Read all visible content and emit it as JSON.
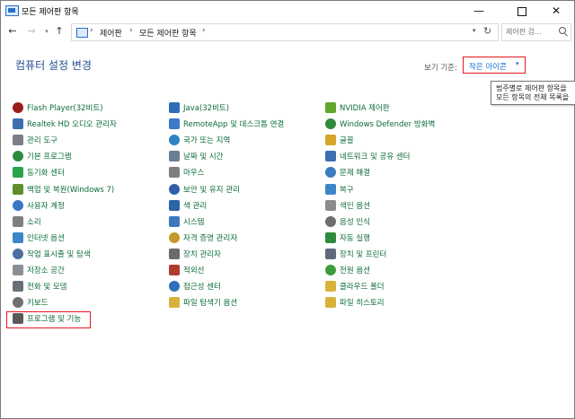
{
  "window": {
    "title": "모든 제어판 항목",
    "minimize": "—",
    "close": "✕"
  },
  "address": {
    "breadcrumb": [
      "제어판",
      "모든 제어판 항목"
    ],
    "separator": "›",
    "dropdown": "▾",
    "refresh": "↻",
    "search_placeholder": "제어판 검..."
  },
  "nav": {
    "back": "←",
    "forward": "→",
    "history": "▾",
    "up": "↑"
  },
  "heading": "컴퓨터 설정 변경",
  "view_by": {
    "label": "보기 기준:",
    "value": "작은 아이콘",
    "arrow": "▾"
  },
  "tooltip": {
    "line1": "범주별로 제어판 항목을",
    "line2": "모든 항목의 전체 목록을"
  },
  "columns": [
    [
      {
        "label": "Flash Player(32비트)",
        "icon": "flash-icon",
        "color": "#9b1c1c"
      },
      {
        "label": "Realtek HD 오디오 관리자",
        "icon": "speaker-icon",
        "color": "#3d6fb0"
      },
      {
        "label": "관리 도구",
        "icon": "admin-tools-icon",
        "color": "#7a7f86"
      },
      {
        "label": "기본 프로그램",
        "icon": "default-programs-icon",
        "color": "#2e8b3e"
      },
      {
        "label": "동기화 센터",
        "icon": "sync-icon",
        "color": "#2aa34a"
      },
      {
        "label": "백업 및 복원(Windows 7)",
        "icon": "backup-icon",
        "color": "#5e8f2a"
      },
      {
        "label": "사용자 계정",
        "icon": "user-icon",
        "color": "#3b78c2"
      },
      {
        "label": "소리",
        "icon": "sound-icon",
        "color": "#7f7f7f"
      },
      {
        "label": "인터넷 옵션",
        "icon": "internet-icon",
        "color": "#3c86c9"
      },
      {
        "label": "작업 표시줄 및 탐색",
        "icon": "taskbar-icon",
        "color": "#4b6f9e"
      },
      {
        "label": "저장소 공간",
        "icon": "storage-icon",
        "color": "#8a8f96"
      },
      {
        "label": "전화 및 모뎀",
        "icon": "phone-icon",
        "color": "#6b7078"
      },
      {
        "label": "키보드",
        "icon": "keyboard-icon",
        "color": "#707070"
      },
      {
        "label": "프로그램 및 기능",
        "icon": "programs-icon",
        "color": "#5a5a5a"
      }
    ],
    [
      {
        "label": "Java(32비트)",
        "icon": "java-icon",
        "color": "#2f6db5"
      },
      {
        "label": "RemoteApp 및 데스크톱 연결",
        "icon": "remote-icon",
        "color": "#3b7bc8"
      },
      {
        "label": "국가 또는 지역",
        "icon": "globe-icon",
        "color": "#2f82c7"
      },
      {
        "label": "날짜 및 시간",
        "icon": "clock-icon",
        "color": "#6a7e96"
      },
      {
        "label": "마우스",
        "icon": "mouse-icon",
        "color": "#7e7e7e"
      },
      {
        "label": "보안 및 유지 관리",
        "icon": "flag-icon",
        "color": "#2f5fa8"
      },
      {
        "label": "색 관리",
        "icon": "color-icon",
        "color": "#2c64a8"
      },
      {
        "label": "시스템",
        "icon": "system-icon",
        "color": "#3d78be"
      },
      {
        "label": "자격 증명 관리자",
        "icon": "credential-icon",
        "color": "#c59a2a"
      },
      {
        "label": "장치 관리자",
        "icon": "device-manager-icon",
        "color": "#6b6b6b"
      },
      {
        "label": "적외선",
        "icon": "infrared-icon",
        "color": "#b03a2e"
      },
      {
        "label": "접근성 센터",
        "icon": "accessibility-icon",
        "color": "#2f6fb8"
      },
      {
        "label": "파일 탐색기 옵션",
        "icon": "folder-options-icon",
        "color": "#d8b23a"
      }
    ],
    [
      {
        "label": "NVIDIA 제어판",
        "icon": "nvidia-icon",
        "color": "#5fa62b"
      },
      {
        "label": "Windows Defender 방화벽",
        "icon": "firewall-icon",
        "color": "#2f8a3d"
      },
      {
        "label": "글꼴",
        "icon": "font-icon",
        "color": "#d7a42a"
      },
      {
        "label": "네트워크 및 공유 센터",
        "icon": "network-icon",
        "color": "#3b6fb0"
      },
      {
        "label": "문제 해결",
        "icon": "troubleshoot-icon",
        "color": "#3a7bc3"
      },
      {
        "label": "복구",
        "icon": "recovery-icon",
        "color": "#3c86c9"
      },
      {
        "label": "색인 옵션",
        "icon": "index-icon",
        "color": "#8c8c8c"
      },
      {
        "label": "음성 인식",
        "icon": "microphone-icon",
        "color": "#6e6e6e"
      },
      {
        "label": "자동 실행",
        "icon": "autoplay-icon",
        "color": "#2e8b3e"
      },
      {
        "label": "장치 및 프린터",
        "icon": "printer-icon",
        "color": "#5d6b7a"
      },
      {
        "label": "전원 옵션",
        "icon": "power-icon",
        "color": "#3d9c3a"
      },
      {
        "label": "클라우드 폴더",
        "icon": "cloud-folder-icon",
        "color": "#d8b23a"
      },
      {
        "label": "파일 히스토리",
        "icon": "file-history-icon",
        "color": "#d9b03b"
      }
    ]
  ]
}
